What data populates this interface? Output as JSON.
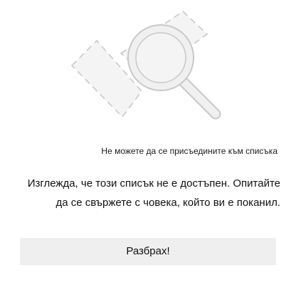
{
  "illustration": {
    "icon": "magnifier-over-missing-list-icon",
    "colors": {
      "dashed_outline": "#c6c6c6",
      "placeholder_fill": "#f4f4f4",
      "magnifier_fill": "#f0f0f0",
      "magnifier_outline": "#c8c8c8"
    }
  },
  "dialog": {
    "subtitle": "Не можете да се присъедините към списъка",
    "message_line1": "Изглежда, че този списък не е достъпен. Опитайте",
    "message_line2": "да се свържете с човека, който ви е поканил.",
    "button_label": "Разбрах!"
  },
  "colors": {
    "background": "#ffffff",
    "button_background": "#efefef",
    "text": "#111111"
  }
}
